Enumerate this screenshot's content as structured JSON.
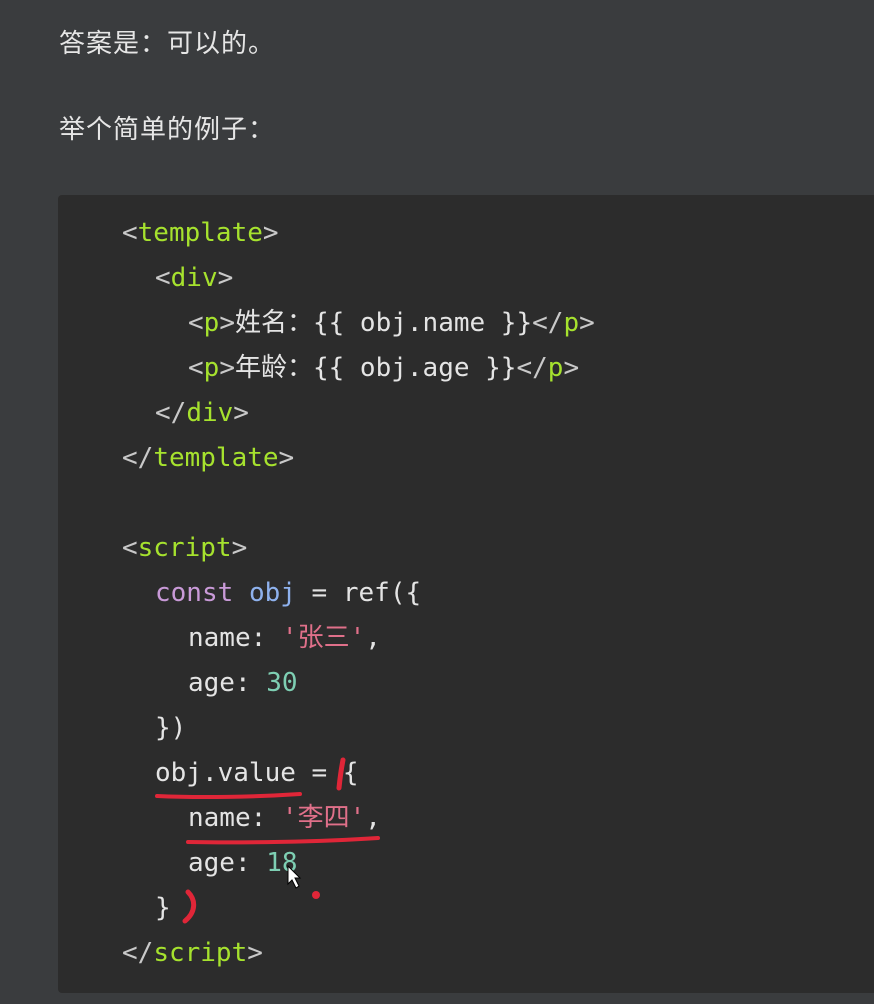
{
  "prose": {
    "answer": "答案是：可以的。",
    "example_intro": "举个简单的例子："
  },
  "code": {
    "template_open": {
      "lt": "<",
      "name": "template",
      "gt": ">"
    },
    "div_open": {
      "lt": "<",
      "name": "div",
      "gt": ">"
    },
    "p_name": {
      "open_lt": "<",
      "open_name": "p",
      "open_gt": ">",
      "text": "姓名：{{ obj.name }}",
      "close_lt": "</",
      "close_name": "p",
      "close_gt": ">"
    },
    "p_age": {
      "open_lt": "<",
      "open_name": "p",
      "open_gt": ">",
      "text": "年龄：{{ obj.age }}",
      "close_lt": "</",
      "close_name": "p",
      "close_gt": ">"
    },
    "div_close": {
      "lt": "</",
      "name": "div",
      "gt": ">"
    },
    "template_close": {
      "lt": "</",
      "name": "template",
      "gt": ">"
    },
    "script_open": {
      "lt": "<",
      "name": "script",
      "gt": ">"
    },
    "const_line": {
      "kw": "const",
      "var": "obj",
      "rest": " = ref({"
    },
    "name_line": {
      "key": "name: ",
      "value": "'张三'",
      "comma": ","
    },
    "age_line": {
      "key": "age: ",
      "value": "30"
    },
    "close_ref": "})",
    "assign_line": {
      "lhs": "obj.value",
      "rest": " = {"
    },
    "name_line2": {
      "key": "name: ",
      "value": "'李四'",
      "comma": ","
    },
    "age_line2": {
      "key": "age: ",
      "value": "18"
    },
    "close_obj": "}",
    "script_close": {
      "lt": "</",
      "name": "script",
      "gt": ">"
    }
  },
  "annotations": {
    "color": "#e02638"
  },
  "colors": {
    "background": "#3a3c3e",
    "code_background": "#2c2c2c",
    "tag": "#a6e22e",
    "keyword": "#c99ad8",
    "variable": "#8fb2ee",
    "string": "#e0708a",
    "number": "#7ecfb3"
  }
}
